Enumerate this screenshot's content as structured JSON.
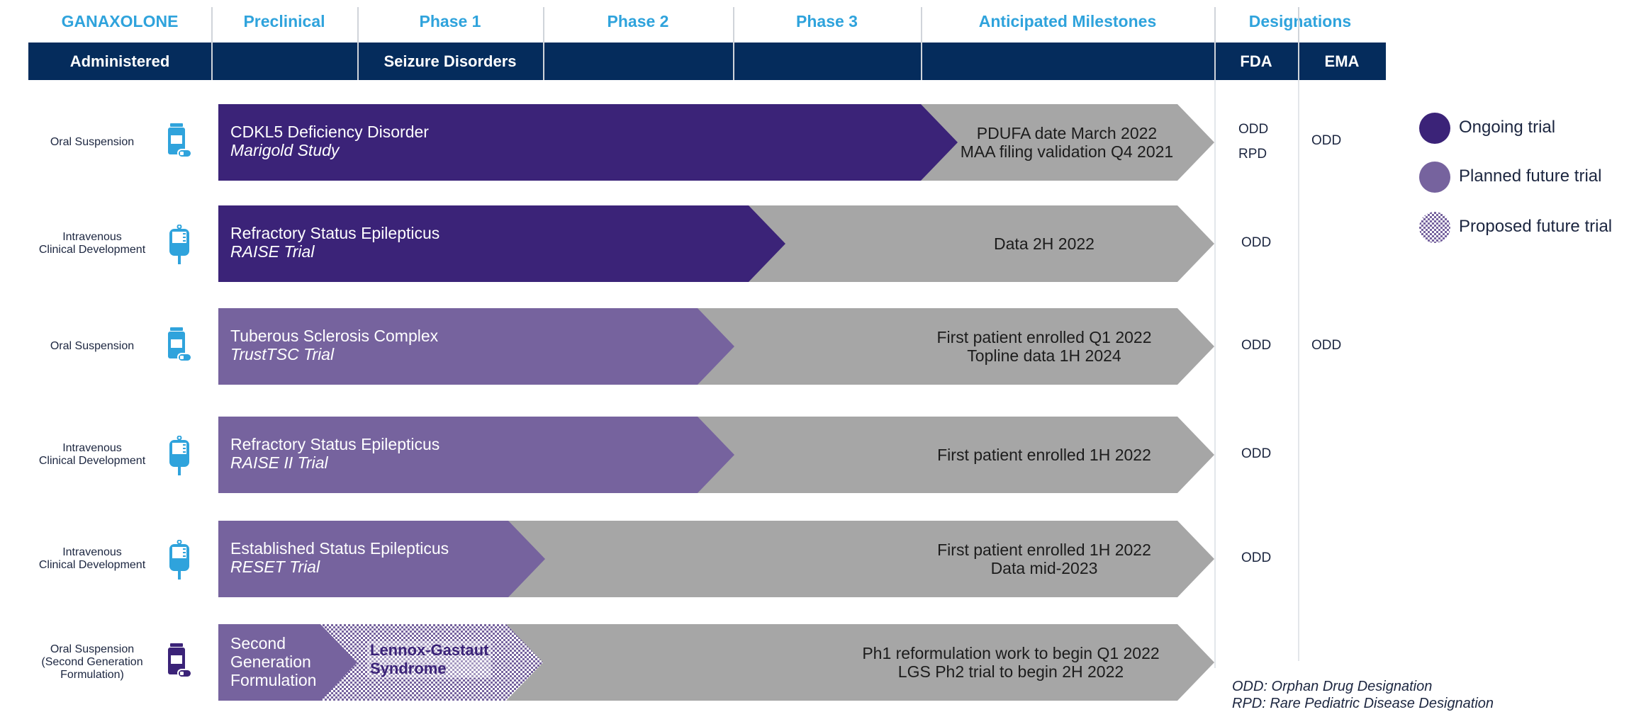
{
  "colors": {
    "navy": "#052c5c",
    "cyan": "#2fa3dc",
    "ongoing": "#3b2378",
    "planned": "#76639e",
    "milestone_grey": "#a6a6a6"
  },
  "header": {
    "columns": [
      "GANAXOLONE",
      "Preclinical",
      "Phase 1",
      "Phase 2",
      "Phase 3",
      "Anticipated Milestones",
      "Designations"
    ],
    "sub": {
      "administered": "Administered",
      "indication": "Seizure Disorders",
      "fda": "FDA",
      "ema": "EMA"
    }
  },
  "rows": [
    {
      "admin": "Oral Suspension",
      "icon": "pill-bottle-icon",
      "status": "ongoing",
      "title": "CDKL5 Deficiency Disorder",
      "trial": "Marigold Study",
      "milestones": [
        "PDUFA date March 2022",
        "MAA filing validation Q4 2021"
      ],
      "fda": [
        "ODD",
        "RPD"
      ],
      "ema": [
        "ODD"
      ]
    },
    {
      "admin": "Intravenous\nClinical Development",
      "icon": "iv-bag-icon",
      "status": "ongoing",
      "title": "Refractory Status Epilepticus",
      "trial": "RAISE Trial",
      "milestones": [
        "Data 2H 2022"
      ],
      "fda": [
        "ODD"
      ],
      "ema": []
    },
    {
      "admin": "Oral Suspension",
      "icon": "pill-bottle-icon",
      "status": "planned",
      "title": "Tuberous Sclerosis Complex",
      "trial": "TrustTSC Trial",
      "milestones": [
        "First patient enrolled Q1 2022",
        "Topline data 1H 2024"
      ],
      "fda": [
        "ODD"
      ],
      "ema": [
        "ODD"
      ]
    },
    {
      "admin": "Intravenous\nClinical Development",
      "icon": "iv-bag-icon",
      "status": "planned",
      "title": "Refractory Status Epilepticus",
      "trial": "RAISE II Trial",
      "milestones": [
        "First patient enrolled 1H 2022"
      ],
      "fda": [
        "ODD"
      ],
      "ema": []
    },
    {
      "admin": "Intravenous\nClinical Development",
      "icon": "iv-bag-icon",
      "status": "planned",
      "title": "Established Status Epilepticus",
      "trial": "RESET Trial",
      "milestones": [
        "First patient enrolled 1H 2022",
        "Data mid-2023"
      ],
      "fda": [
        "ODD"
      ],
      "ema": []
    },
    {
      "admin": "Oral Suspension\n(Second Generation\nFormulation)",
      "icon": "pill-bottle-icon",
      "status": "planned+proposed",
      "title": "Second\nGeneration\nFormulation",
      "trial": "",
      "proposed": "Lennox-Gastaut\nSyndrome",
      "milestones": [
        "Ph1 reformulation work to begin Q1 2022",
        "LGS Ph2 trial to begin 2H 2022"
      ],
      "fda": [],
      "ema": []
    }
  ],
  "legend": [
    {
      "label": "Ongoing trial",
      "style": "ongoing"
    },
    {
      "label": "Planned future trial",
      "style": "planned"
    },
    {
      "label": "Proposed future trial",
      "style": "proposed"
    }
  ],
  "footnotes": [
    "ODD: Orphan Drug Designation",
    "RPD: Rare Pediatric Disease Designation"
  ]
}
